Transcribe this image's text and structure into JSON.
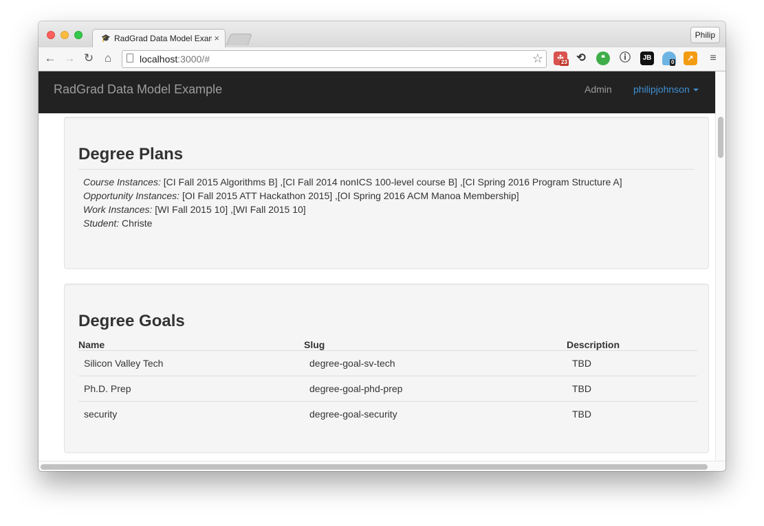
{
  "browser": {
    "tab_title": "RadGrad Data Model Exam",
    "profile": "Philip",
    "url_host": "localhost",
    "url_rest": ":3000/#",
    "ext_badge_1": "23",
    "ext_badge_2": "0",
    "ext_jb": "JB"
  },
  "navbar": {
    "brand": "RadGrad Data Model Example",
    "admin": "Admin",
    "user": "philipjohnson"
  },
  "degree_plans": {
    "heading": "Degree Plans",
    "course_label": "Course Instances:",
    "course_value": " [CI Fall 2015 Algorithms B] ,[CI Fall 2014 nonICS 100-level course B] ,[CI Spring 2016 Program Structure A]",
    "opp_label": "Opportunity Instances:",
    "opp_value": " [OI Fall 2015 ATT Hackathon 2015] ,[OI Spring 2016 ACM Manoa Membership]",
    "work_label": "Work Instances:",
    "work_value": " [WI Fall 2015 10] ,[WI Fall 2015 10]",
    "student_label": "Student:",
    "student_value": " Christe"
  },
  "degree_goals": {
    "heading": "Degree Goals",
    "columns": [
      "Name",
      "Slug",
      "Description"
    ],
    "rows": [
      [
        "Silicon Valley Tech",
        "degree-goal-sv-tech",
        "TBD"
      ],
      [
        "Ph.D. Prep",
        "degree-goal-phd-prep",
        "TBD"
      ],
      [
        "security",
        "degree-goal-security",
        "TBD"
      ]
    ]
  }
}
